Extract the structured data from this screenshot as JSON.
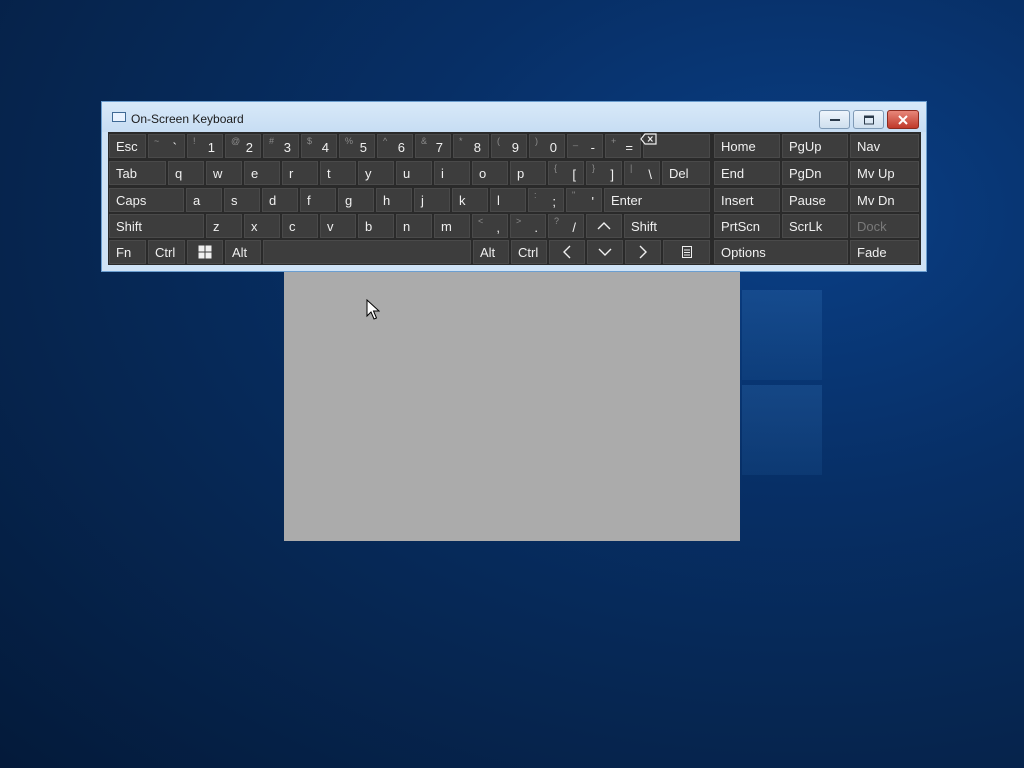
{
  "window": {
    "title": "On-Screen Keyboard",
    "controls": {
      "minimize": "minimize",
      "maximize": "maximize",
      "close": "close"
    }
  },
  "rows": {
    "r1": {
      "esc": "Esc",
      "k_tilde": {
        "sec": "~",
        "pri": "`"
      },
      "k1": {
        "sec": "!",
        "pri": "1"
      },
      "k2": {
        "sec": "@",
        "pri": "2"
      },
      "k3": {
        "sec": "#",
        "pri": "3"
      },
      "k4": {
        "sec": "$",
        "pri": "4"
      },
      "k5": {
        "sec": "%",
        "pri": "5"
      },
      "k6": {
        "sec": "^",
        "pri": "6"
      },
      "k7": {
        "sec": "&",
        "pri": "7"
      },
      "k8": {
        "sec": "*",
        "pri": "8"
      },
      "k9": {
        "sec": "(",
        "pri": "9"
      },
      "k0": {
        "sec": ")",
        "pri": "0"
      },
      "k_minus": {
        "sec": "_",
        "pri": "-"
      },
      "k_equal": {
        "sec": "+",
        "pri": "="
      },
      "backspace_icon": "backspace-icon"
    },
    "r2": {
      "tab": "Tab",
      "q": "q",
      "w": "w",
      "e": "e",
      "r": "r",
      "t": "t",
      "y": "y",
      "u": "u",
      "i": "i",
      "o": "o",
      "p": "p",
      "k_lbracket": {
        "sec": "{",
        "pri": "["
      },
      "k_rbracket": {
        "sec": "}",
        "pri": "]"
      },
      "k_backslash": {
        "sec": "|",
        "pri": "\\"
      },
      "del": "Del"
    },
    "r3": {
      "caps": "Caps",
      "a": "a",
      "s": "s",
      "d": "d",
      "f": "f",
      "g": "g",
      "h": "h",
      "j": "j",
      "k": "k",
      "l": "l",
      "k_semicolon": {
        "sec": ":",
        "pri": ";"
      },
      "k_quote": {
        "sec": "\"",
        "pri": "'"
      },
      "enter": "Enter"
    },
    "r4": {
      "shift_l": "Shift",
      "z": "z",
      "x": "x",
      "c": "c",
      "v": "v",
      "b": "b",
      "n": "n",
      "m": "m",
      "k_comma": {
        "sec": "<",
        "pri": ","
      },
      "k_period": {
        "sec": ">",
        "pri": "."
      },
      "k_slash": {
        "sec": "?",
        "pri": "/"
      },
      "up_icon": "chevron-up-icon",
      "shift_r": "Shift"
    },
    "r5": {
      "fn": "Fn",
      "ctrl_l": "Ctrl",
      "win_icon": "windows-logo-icon",
      "alt_l": "Alt",
      "alt_r": "Alt",
      "ctrl_r": "Ctrl",
      "left_icon": "chevron-left-icon",
      "down_icon": "chevron-down-icon",
      "right_icon": "chevron-right-icon",
      "menu_icon": "menu-key-icon"
    }
  },
  "nav": {
    "home": "Home",
    "pgup": "PgUp",
    "nav": "Nav",
    "end": "End",
    "pgdn": "PgDn",
    "mvup": "Mv Up",
    "insert": "Insert",
    "pause": "Pause",
    "mvdn": "Mv Dn",
    "prtscn": "PrtScn",
    "scrlk": "ScrLk",
    "dock": "Dock",
    "options": "Options",
    "fade": "Fade"
  },
  "colors": {
    "key_bg": "#3d3d3d",
    "keyboard_bg": "#2a2a2a",
    "key_text": "#f0f0f0",
    "disabled_text": "#7a7a7a",
    "titlebar": "#cfe3f6",
    "desktop": "#072f66"
  }
}
